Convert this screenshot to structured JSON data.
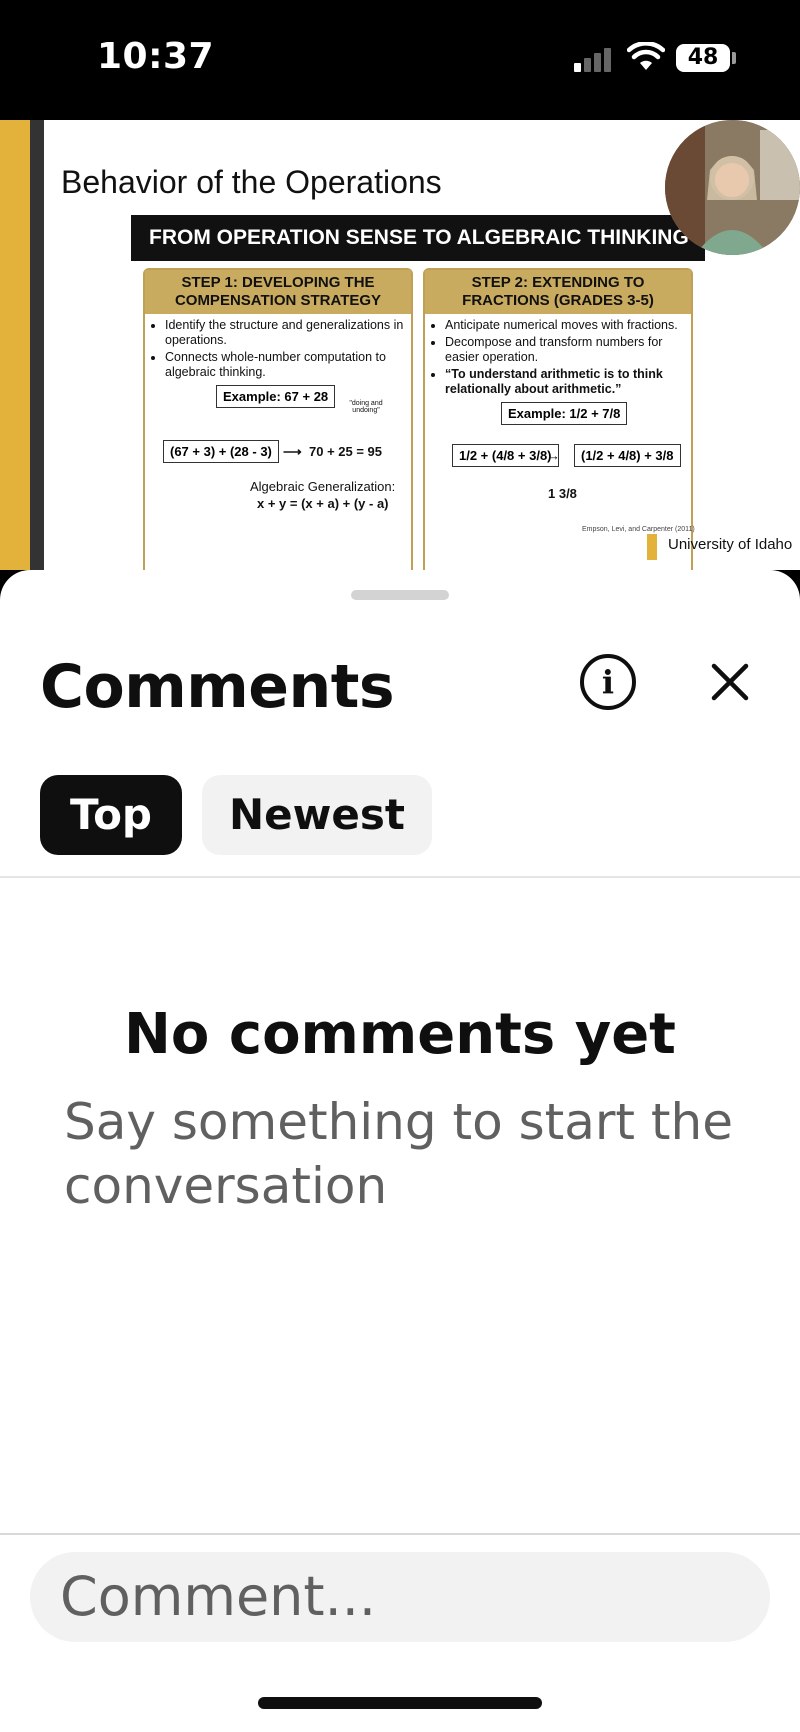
{
  "status_bar": {
    "time": "10:37",
    "battery": "48",
    "signal_icon": "cellular-signal-icon",
    "wifi_icon": "wifi-icon"
  },
  "video": {
    "slide_title": "Behavior of the Operations",
    "banner": "FROM OPERATION SENSE TO ALGEBRAIC THINKING",
    "step1": {
      "heading_line1": "STEP 1: DEVELOPING THE",
      "heading_line2": "COMPENSATION STRATEGY",
      "bullets": [
        "Identify the structure and generalizations in operations.",
        "Connects whole-number computation to algebraic thinking."
      ],
      "example": "Example: 67 + 28",
      "cycle_label": "\"doing and undoing\"",
      "expr": "(67 + 3) + (28 - 3)",
      "result": "70 + 25 = 95",
      "gen_label": "Algebraic Generalization:",
      "gen_expr": "x + y = (x + a) + (y - a)"
    },
    "step2": {
      "heading_line1": "STEP 2: EXTENDING TO",
      "heading_line2": "FRACTIONS (GRADES 3-5)",
      "bullets": [
        "Anticipate numerical moves with fractions.",
        "Decompose and transform numbers for easier operation.",
        "“To understand arithmetic is to think relationally about arithmetic.”"
      ],
      "example": "Example: 1/2 + 7/8",
      "expr_left": "1/2 + (4/8 + 3/8)",
      "expr_right": "(1/2 + 4/8) + 3/8",
      "answer": "1 3/8"
    },
    "credit": "Empson, Levi, and Carpenter (2011)",
    "university": "University of Idaho",
    "progress_fraction": 0.26,
    "colors": {
      "gold": "#e2b23a",
      "progress": "#e9323f"
    }
  },
  "comments_sheet": {
    "title": "Comments",
    "info_icon": "info-icon",
    "close_icon": "close-icon",
    "tabs": [
      {
        "label": "Top",
        "selected": true
      },
      {
        "label": "Newest",
        "selected": false
      }
    ],
    "empty_title": "No comments yet",
    "empty_subtitle": "Say something to start the conversation",
    "comment_placeholder": "Comment..."
  }
}
